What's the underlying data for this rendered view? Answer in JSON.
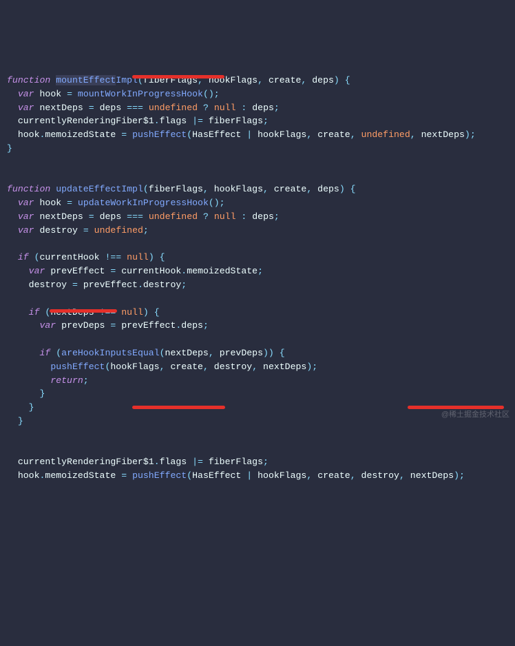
{
  "watermark": "@稀土掘金技术社区",
  "kw": {
    "function": "function",
    "var": "var",
    "if": "if",
    "return": "return"
  },
  "const": {
    "undefined": "undefined",
    "null": "null"
  },
  "fn": {
    "mountEffectImpl": "mountEffectImpl",
    "mountWorkInProgressHook": "mountWorkInProgressHook",
    "pushEffect": "pushEffect",
    "updateEffectImpl": "updateEffectImpl",
    "updateWorkInProgressHook": "updateWorkInProgressHook",
    "areHookInputsEqual": "areHookInputsEqual"
  },
  "id": {
    "fiberFlags": "fiberFlags",
    "hookFlags": "hookFlags",
    "create": "create",
    "deps": "deps",
    "hook": "hook",
    "nextDeps": "nextDeps",
    "currentlyRenderingFiber1": "currentlyRenderingFiber$1",
    "flags": "flags",
    "memoizedState": "memoizedState",
    "HasEffect": "HasEffect",
    "destroy": "destroy",
    "currentHook": "currentHook",
    "prevEffect": "prevEffect",
    "prevDeps": "prevDeps"
  },
  "hl": "mountEffect",
  "underlines": [
    {
      "note": "pushEffect call in mountEffectImpl"
    },
    {
      "note": "pushEffect call inside if(areHookInputsEqual)"
    },
    {
      "note": "pushEffect call at end of updateEffectImpl (left)"
    },
    {
      "note": "destroy, nextDeps at end of updateEffectImpl (right)"
    }
  ]
}
